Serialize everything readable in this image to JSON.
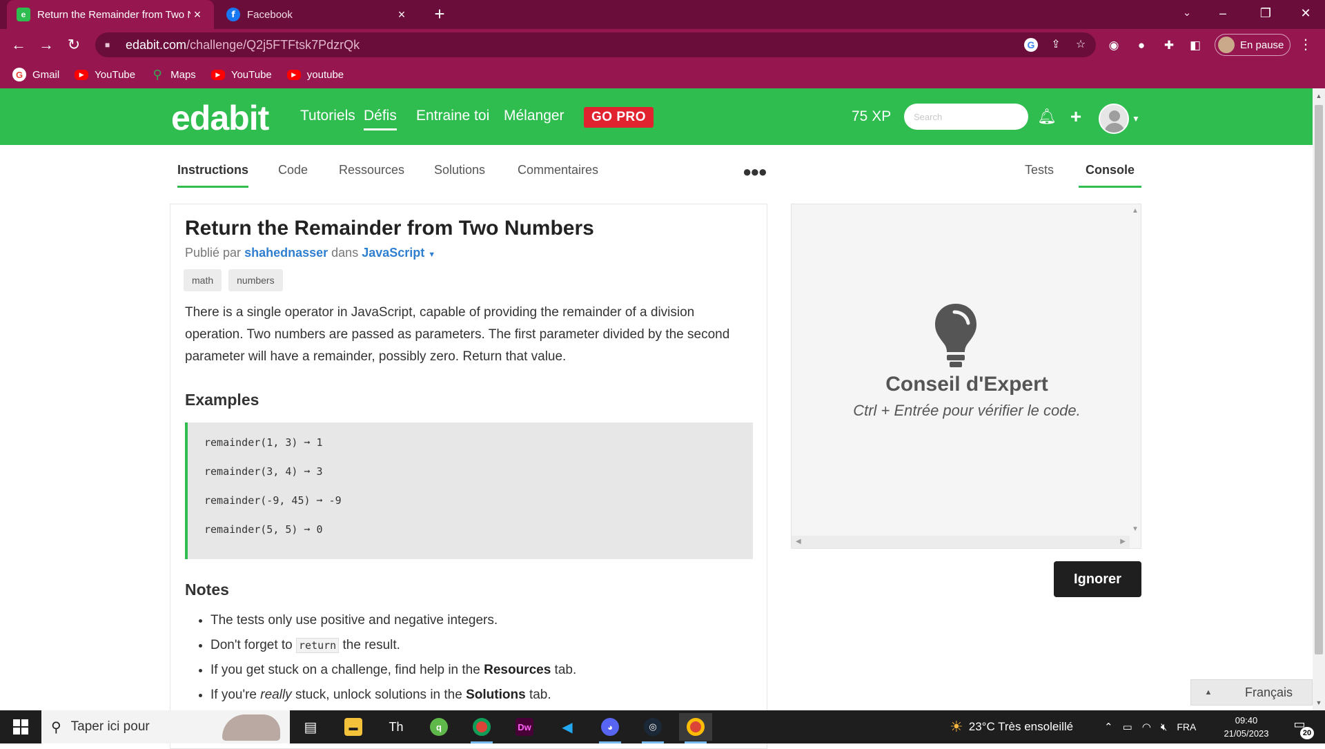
{
  "browser": {
    "tabs": [
      {
        "title": "Return the Remainder from Two N",
        "active": true
      },
      {
        "title": "Facebook",
        "active": false
      }
    ],
    "url_domain": "edabit.com",
    "url_path": "/challenge/Q2j5FTFtsk7PdzrQk",
    "profile_label": "En pause",
    "bookmarks": [
      "Gmail",
      "YouTube",
      "Maps",
      "YouTube",
      "youtube"
    ]
  },
  "header": {
    "logo": "edabit",
    "nav": [
      "Tutoriels",
      "Défis",
      "Entraine toi",
      "Mélanger"
    ],
    "active_nav": "Défis",
    "gopro": "GO PRO",
    "xp": "75 XP",
    "search_placeholder": "Search"
  },
  "tabs": {
    "left": [
      "Instructions",
      "Code",
      "Ressources",
      "Solutions",
      "Commentaires"
    ],
    "right": [
      "Tests",
      "Console"
    ],
    "active_left": "Instructions",
    "active_right": "Console"
  },
  "challenge": {
    "title": "Return the Remainder from Two Numbers",
    "published_by_prefix": "Publié par",
    "author": "shahednasser",
    "in_word": "dans",
    "language": "JavaScript",
    "tags": [
      "math",
      "numbers"
    ],
    "description": "There is a single operator in JavaScript, capable of providing the remainder of a division operation. Two numbers are passed as parameters. The first parameter divided by the second parameter will have a remainder, possibly zero. Return that value.",
    "examples_heading": "Examples",
    "examples": [
      "remainder(1, 3) ➞ 1",
      "remainder(3, 4) ➞ 3",
      "remainder(-9, 45) ➞ -9",
      "remainder(5, 5) ➞ 0"
    ],
    "notes_heading": "Notes",
    "notes": {
      "n1": "The tests only use positive and negative integers.",
      "n2_pre": "Don't forget to ",
      "n2_code": "return",
      "n2_post": " the result.",
      "n3_pre": "If you get stuck on a challenge, find help in the ",
      "n3_bold": "Resources",
      "n3_post": " tab.",
      "n4_pre": "If you're ",
      "n4_em": "really",
      "n4_mid": " stuck, unlock solutions in the ",
      "n4_bold": "Solutions",
      "n4_post": " tab."
    }
  },
  "console": {
    "tip_title": "Conseil d'Expert",
    "tip_text": "Ctrl + Entrée pour vérifier le code.",
    "ignore_label": "Ignorer"
  },
  "language_button": "Français",
  "taskbar": {
    "search_placeholder": "Taper ici pour",
    "weather": "23°C  Très ensoleillé",
    "lang": "FRA",
    "time": "09:40",
    "date": "21/05/2023",
    "notif_count": "20"
  },
  "colors": {
    "brand_green": "#2fbd4f",
    "gopro_red": "#e0232e",
    "chrome_dark": "#6b0d3a",
    "chrome_light": "#96164f",
    "link_blue": "#2f7fd1"
  }
}
